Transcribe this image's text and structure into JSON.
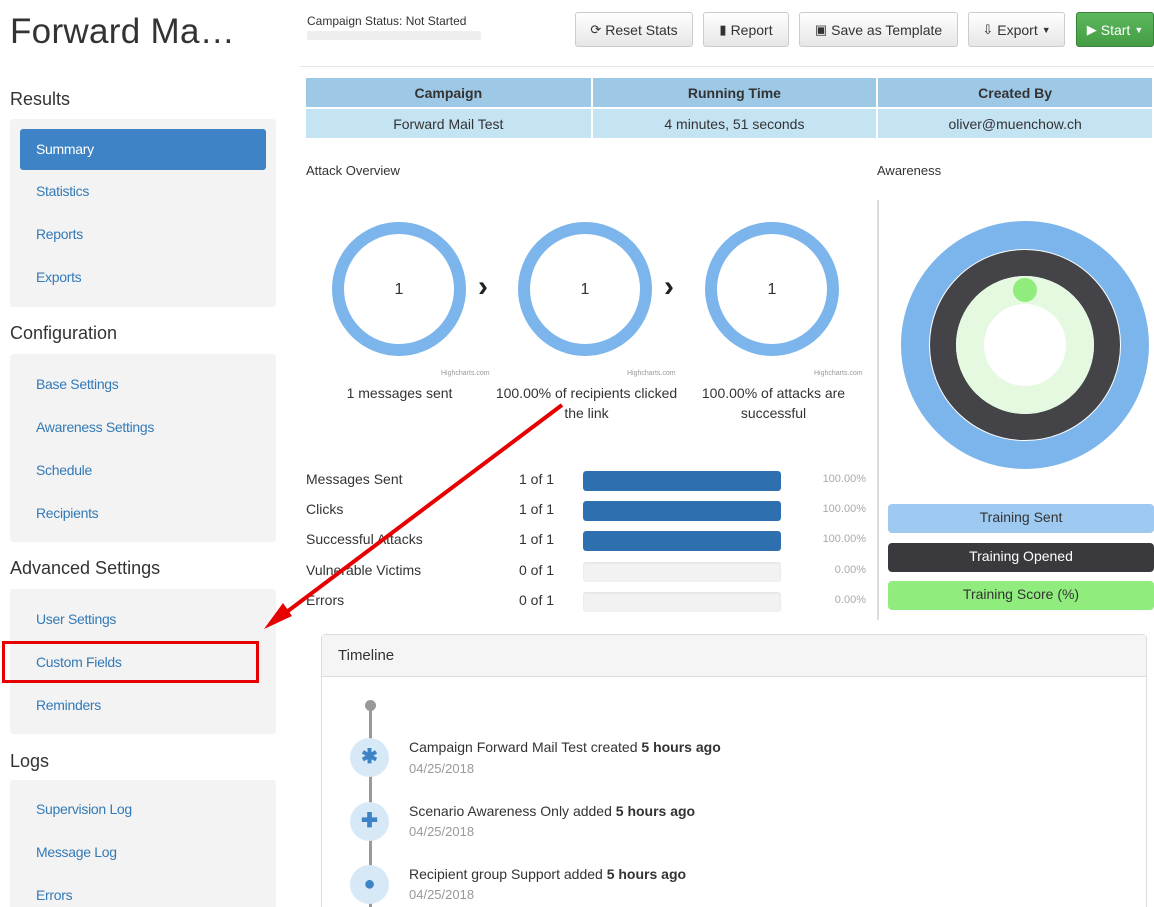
{
  "header": {
    "title": "Forward Ma…",
    "status_label": "Campaign Status:  Not Started",
    "buttons": {
      "reset": "Reset Stats",
      "report": "Report",
      "save_template": "Save as Template",
      "export": "Export",
      "start": "Start"
    }
  },
  "sidebar": {
    "results": {
      "title": "Results",
      "items": [
        "Summary",
        "Statistics",
        "Reports",
        "Exports"
      ]
    },
    "configuration": {
      "title": "Configuration",
      "items": [
        "Base Settings",
        "Awareness Settings",
        "Schedule",
        "Recipients"
      ]
    },
    "advanced": {
      "title": "Advanced Settings",
      "items": [
        "User Settings",
        "Custom Fields",
        "Reminders"
      ]
    },
    "logs": {
      "title": "Logs",
      "items": [
        "Supervision Log",
        "Message Log",
        "Errors"
      ]
    }
  },
  "info_table": {
    "headers": [
      "Campaign",
      "Running Time",
      "Created By"
    ],
    "values": [
      "Forward Mail Test",
      "4 minutes, 51 seconds",
      "oliver@muenchow.ch"
    ]
  },
  "attack_overview": {
    "title": "Attack Overview",
    "rings": [
      {
        "value": "1",
        "caption": "1 messages sent"
      },
      {
        "value": "1",
        "caption": "100.00% of recipients clicked the link"
      },
      {
        "value": "1",
        "caption": "100.00% of attacks are successful"
      }
    ],
    "credit": "Highcharts.com"
  },
  "awareness": {
    "title": "Awareness",
    "legend": [
      "Training Sent",
      "Training Opened",
      "Training Score (%)"
    ],
    "colors": {
      "sent": "#7cb5ec",
      "opened": "#434348",
      "score": "#90ed7d"
    }
  },
  "stats": [
    {
      "name": "Messages Sent",
      "frac": "1 of 1",
      "pct": "100.00%",
      "level": 1.0
    },
    {
      "name": "Clicks",
      "frac": "1 of 1",
      "pct": "100.00%",
      "level": 1.0
    },
    {
      "name": "Successful Attacks",
      "frac": "1 of 1",
      "pct": "100.00%",
      "level": 1.0
    },
    {
      "name": "Vulnerable Victims",
      "frac": "0 of 1",
      "pct": "0.00%",
      "level": 0.0
    },
    {
      "name": "Errors",
      "frac": "0 of 1",
      "pct": "0.00%",
      "level": 0.0
    }
  ],
  "timeline": {
    "title": "Timeline",
    "events": [
      {
        "text": "Campaign Forward Mail Test created",
        "ago": "5 hours ago",
        "date": "04/25/2018",
        "icon": "asterisk-icon"
      },
      {
        "text": "Scenario Awareness Only added",
        "ago": "5 hours ago",
        "date": "04/25/2018",
        "icon": "plus-icon"
      },
      {
        "text": "Recipient group Support added",
        "ago": "5 hours ago",
        "date": "04/25/2018",
        "icon": "user-icon"
      }
    ]
  }
}
